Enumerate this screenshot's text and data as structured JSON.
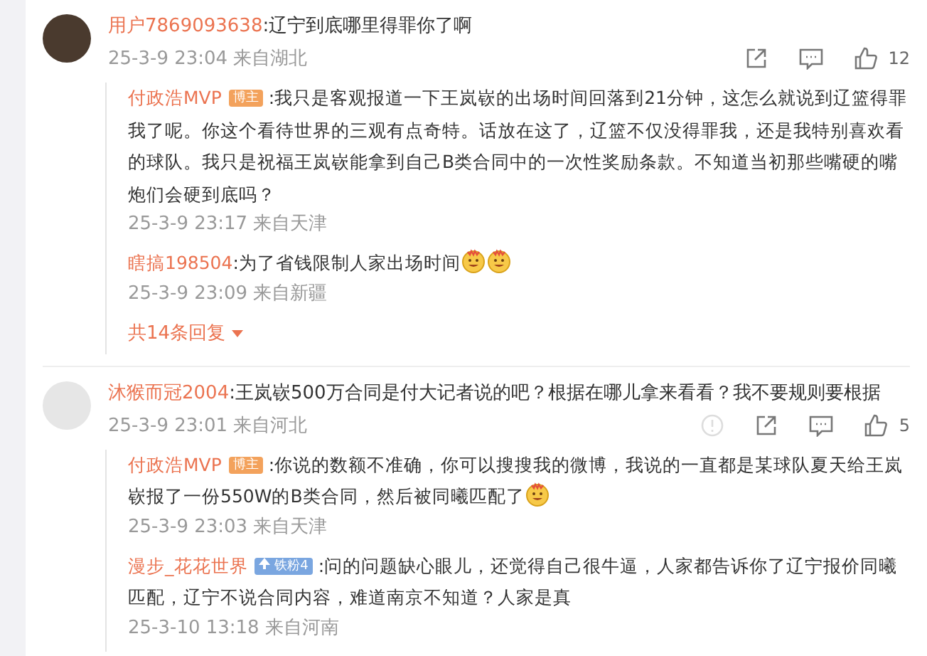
{
  "comments": [
    {
      "user": "用户7869093638",
      "text": ":辽宁到底哪里得罪你了啊",
      "time": "25-3-9 23:04",
      "location": "来自湖北",
      "actions": [
        {
          "kind": "share"
        },
        {
          "kind": "comment"
        },
        {
          "kind": "like",
          "count": "12"
        }
      ],
      "replies": [
        {
          "user": "付政浩MVP",
          "badge": {
            "kind": "author",
            "label": "博主"
          },
          "text": ":我只是客观报道一下王岚嵚的出场时间回落到21分钟，这怎么就说到辽篮得罪我了呢。你这个看待世界的三观有点奇特。话放在这了，辽篮不仅没得罪我，还是我特别喜欢看的球队。我只是祝福王岚嵚能拿到自己B类合同中的一次性奖励条款。不知道当初那些嘴硬的嘴炮们会硬到底吗？",
          "time": "25-3-9 23:17",
          "location": "来自天津"
        },
        {
          "user": "瞎搞198504",
          "text": ":为了省钱限制人家出场时间",
          "emojis": [
            {
              "kind": "grin"
            },
            {
              "kind": "grin"
            }
          ],
          "time": "25-3-9 23:09",
          "location": "来自新疆"
        }
      ],
      "more": "共14条回复"
    },
    {
      "user": "沐猴而冠2004",
      "text": ":王岚嵚500万合同是付大记者说的吧？根据在哪儿拿来看看？我不要规则要根据",
      "time": "25-3-9 23:01",
      "location": "来自河北",
      "actions": [
        {
          "kind": "report"
        },
        {
          "kind": "share"
        },
        {
          "kind": "comment"
        },
        {
          "kind": "like",
          "count": "5"
        }
      ],
      "replies": [
        {
          "user": "付政浩MVP",
          "badge": {
            "kind": "author",
            "label": "博主"
          },
          "text": ":你说的数额不准确，你可以搜搜我的微博，我说的一直都是某球队夏天给王岚嵚报了一份550W的B类合同，然后被同曦匹配了",
          "emojis": [
            {
              "kind": "grin"
            }
          ],
          "time": "25-3-9 23:03",
          "location": "来自天津"
        },
        {
          "user": "漫步_花花世界",
          "badge": {
            "kind": "fan",
            "label": "铁粉4"
          },
          "text": ":问的问题缺心眼儿，还觉得自己很牛逼，人家都告诉你了辽宁报价同曦匹配，辽宁不说合同内容，难道南京不知道？人家是真",
          "time": "25-3-10 13:18",
          "location": "来自河南"
        }
      ]
    }
  ]
}
